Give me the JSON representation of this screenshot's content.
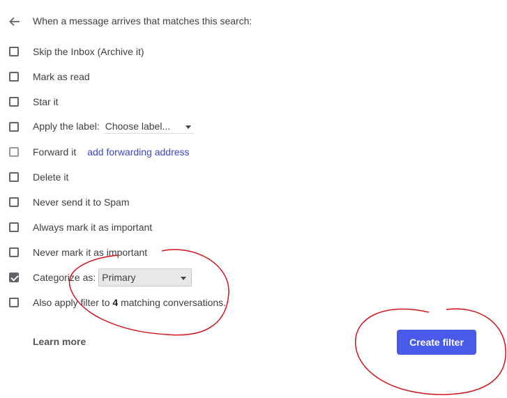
{
  "header": {
    "back_icon": "arrow-left-icon",
    "title": "When a message arrives that matches this search:"
  },
  "options": [
    {
      "label": "Skip the Inbox (Archive it)",
      "checked": false
    },
    {
      "label": "Mark as read",
      "checked": false
    },
    {
      "label": "Star it",
      "checked": false
    },
    {
      "label": "Apply the label:",
      "checked": false,
      "select_value": "Choose label..."
    },
    {
      "label": "Forward it",
      "checked": false,
      "link": "add forwarding address"
    },
    {
      "label": "Delete it",
      "checked": false
    },
    {
      "label": "Never send it to Spam",
      "checked": false
    },
    {
      "label": "Always mark it as important",
      "checked": false
    },
    {
      "label": "Never mark it as important",
      "checked": false
    },
    {
      "label": "Categorize as:",
      "checked": true,
      "select_value": "Primary"
    },
    {
      "label_prefix": "Also apply filter to ",
      "count": "4",
      "label_suffix": " matching conversations.",
      "checked": false
    }
  ],
  "footer": {
    "learn_more": "Learn more",
    "create_filter": "Create filter"
  },
  "colors": {
    "button": "#4a5ae8",
    "link": "#3c46c4",
    "annotation": "#d0121b"
  }
}
